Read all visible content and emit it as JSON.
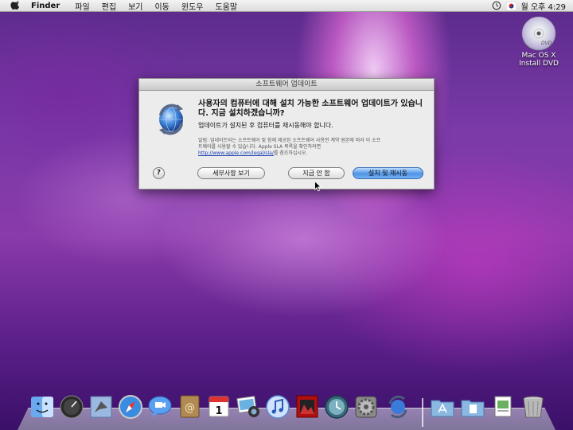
{
  "menubar": {
    "app_name": "Finder",
    "menus": [
      "파일",
      "편집",
      "보기",
      "이동",
      "윈도우",
      "도움말"
    ],
    "time": "월 오후 4:29"
  },
  "desktop": {
    "dvd_label_line1": "Mac OS X",
    "dvd_label_line2": "Install DVD",
    "dvd_badge": "DVD"
  },
  "dialog": {
    "title": "소프트웨어 업데이트",
    "heading": "사용자의 컴퓨터에 대해 설치 가능한 소프트웨어 업데이트가 있습니다. 지금 설치하겠습니까?",
    "subtext": "업데이트가 설치된 후 컴퓨터를 재시동해야 합니다.",
    "notice_text": "알림: 업데이트되는 소프트웨어 및 함께 제공된 소프트웨어 사용권 계약 원본에 따라 이 소프트웨어를 사용할 수 있습니다. Apple SLA 목록을 확인하려면",
    "notice_link": "http://www.apple.com/legal/sla/",
    "notice_suffix": "를 참조하십시오.",
    "help_label": "?",
    "buttons": {
      "details": "세부사항 보기",
      "later": "지금 안 함",
      "install": "설치 및 재시동"
    }
  },
  "dock": {
    "items": [
      "finder-icon",
      "dashboard-icon",
      "mail-icon",
      "safari-icon",
      "ichat-icon",
      "address-book-icon",
      "ical-icon",
      "iphoto-icon",
      "itunes-icon",
      "photo-booth-icon",
      "time-machine-icon",
      "system-preferences-icon",
      "software-update-icon",
      "applications-folder-icon",
      "documents-folder-icon",
      "downloads-stack-icon",
      "trash-icon"
    ],
    "ical_day": "1"
  }
}
